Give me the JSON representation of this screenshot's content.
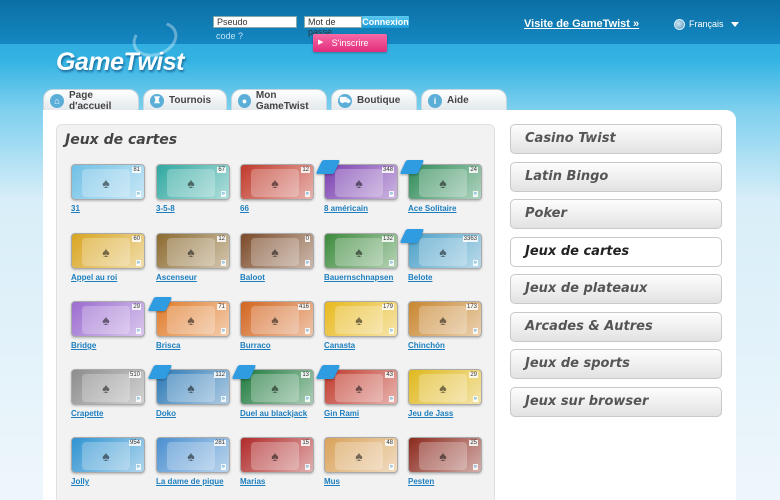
{
  "header": {
    "logo": "GameTwist",
    "username_placeholder": "Pseudo",
    "password_placeholder": "Mot de passe",
    "login_label": "Connexion",
    "code_link": "code ?",
    "signup_label": "S'inscrire",
    "visit_link": "Visite de GameTwist »",
    "language": "Français"
  },
  "tabs": [
    {
      "label": "Page d'accueil",
      "icon": "home-icon"
    },
    {
      "label": "Tournois",
      "icon": "trophy-icon"
    },
    {
      "label": "Mon GameTwist",
      "icon": "user-icon"
    },
    {
      "label": "Boutique",
      "icon": "cart-icon"
    },
    {
      "label": "Aide",
      "icon": "info-icon"
    }
  ],
  "section_title": "Jeux de cartes",
  "games": [
    {
      "name": "31",
      "count": "81",
      "color": "#6fc0e6",
      "new": false
    },
    {
      "name": "3-5-8",
      "count": "67",
      "color": "#2fa8a0",
      "new": false
    },
    {
      "name": "66",
      "count": "12",
      "color": "#c0392b",
      "new": false
    },
    {
      "name": "8 américain",
      "count": "348",
      "color": "#7a3fb0",
      "new": true
    },
    {
      "name": "Ace Solitaire",
      "count": "24",
      "color": "#2e8b57",
      "new": true
    },
    {
      "name": "Appel au roi",
      "count": "60",
      "color": "#d9a521",
      "new": false
    },
    {
      "name": "Ascenseur",
      "count": "12",
      "color": "#8b6a2f",
      "new": false
    },
    {
      "name": "Baloot",
      "count": "0",
      "color": "#7b4a28",
      "new": false
    },
    {
      "name": "Bauernschnapsen",
      "count": "132",
      "color": "#3c8a3c",
      "new": false
    },
    {
      "name": "Belote",
      "count": "3363",
      "color": "#4ba0c8",
      "new": true
    },
    {
      "name": "Bridge",
      "count": "29",
      "color": "#9b6cd0",
      "new": false
    },
    {
      "name": "Brisca",
      "count": "71",
      "color": "#e07b2a",
      "new": true
    },
    {
      "name": "Burraco",
      "count": "416",
      "color": "#d3651f",
      "new": false
    },
    {
      "name": "Canasta",
      "count": "179",
      "color": "#e8b91e",
      "new": false
    },
    {
      "name": "Chinchón",
      "count": "173",
      "color": "#c8862f",
      "new": false
    },
    {
      "name": "Crapette",
      "count": "510",
      "color": "#8c8c8c",
      "new": false
    },
    {
      "name": "Doko",
      "count": "112",
      "color": "#2b78b5",
      "new": true
    },
    {
      "name": "Duel au blackjack",
      "count": "13",
      "color": "#1f7a3d",
      "new": true
    },
    {
      "name": "Gin Rami",
      "count": "43",
      "color": "#c0392b",
      "new": true
    },
    {
      "name": "Jeu de Jass",
      "count": "29",
      "color": "#e0b81e",
      "new": false
    },
    {
      "name": "Jolly",
      "count": "954",
      "color": "#2f93d1",
      "new": false
    },
    {
      "name": "La dame de pique",
      "count": "281",
      "color": "#4a8fd0",
      "new": false
    },
    {
      "name": "Marias",
      "count": "15",
      "color": "#b02a2a",
      "new": false
    },
    {
      "name": "Mus",
      "count": "48",
      "color": "#d9a25a",
      "new": false
    },
    {
      "name": "Pesten",
      "count": "25",
      "color": "#8b2a1e",
      "new": false
    }
  ],
  "more_label": "»",
  "categories": [
    {
      "label": "Casino Twist",
      "active": false
    },
    {
      "label": "Latin Bingo",
      "active": false
    },
    {
      "label": "Poker",
      "active": false
    },
    {
      "label": "Jeux de cartes",
      "active": true
    },
    {
      "label": "Jeux de plateaux",
      "active": false
    },
    {
      "label": "Arcades & Autres",
      "active": false
    },
    {
      "label": "Jeux de sports",
      "active": false
    },
    {
      "label": "Jeux sur browser",
      "active": false
    }
  ]
}
